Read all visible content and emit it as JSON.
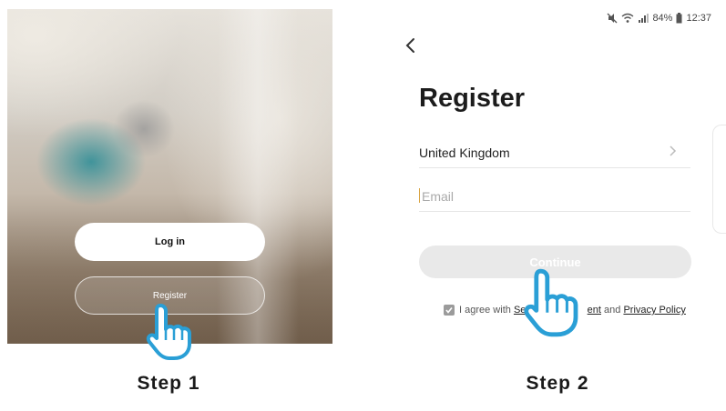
{
  "step1": {
    "login_label": "Log in",
    "register_label": "Register",
    "caption": "Step 1"
  },
  "step2": {
    "status_bar": {
      "battery": "84%",
      "time": "12:37"
    },
    "title": "Register",
    "country": "United Kingdom",
    "email_placeholder": "Email",
    "continue_label": "Continue",
    "agree_prefix": "I agree with",
    "service_agreement_partial_start": "Se",
    "service_agreement_partial_end": "ent",
    "agree_and": "and",
    "privacy_policy": "Privacy Policy",
    "caption": "Step 2"
  },
  "colors": {
    "accent_caret": "#d9a441",
    "hand_outline": "#2a9fd6",
    "continue_disabled": "#e9e9e9"
  },
  "icons": [
    "back-arrow-icon",
    "chevron-right-icon",
    "checkbox-checked-icon",
    "mute-icon",
    "wifi-icon",
    "signal-icon",
    "battery-icon",
    "pointing-hand-icon"
  ]
}
